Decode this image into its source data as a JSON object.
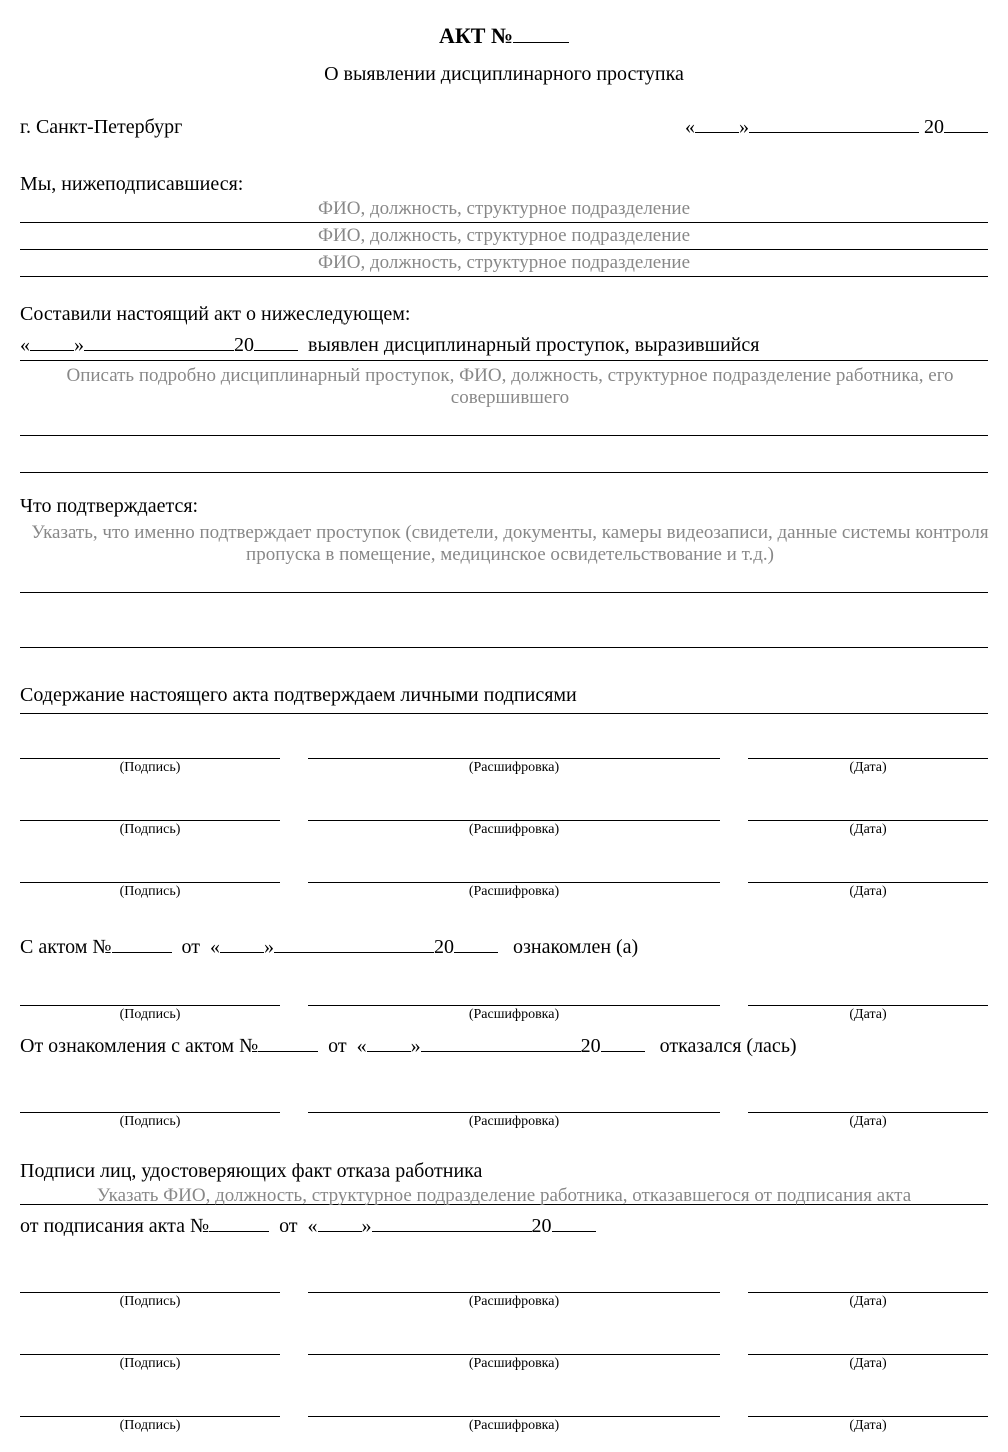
{
  "header": {
    "act_label": "АКТ №",
    "subtitle": "О выявлении дисциплинарного проступка"
  },
  "city": "г. Санкт-Петербург",
  "date_parts": {
    "open": "«",
    "close": "»",
    "year_prefix": "20"
  },
  "signers_intro": "Мы, нижеподписавшиеся:",
  "signers_hint": "ФИО, должность, структурное подразделение",
  "act_body": {
    "intro": "Составили настоящий акт о нижеследующем:",
    "detected_text": "выявлен дисциплинарный проступок, выразившийся",
    "detected_hint": "Описать подробно дисциплинарный проступок, ФИО, должность, структурное подразделение работника, его совершившего"
  },
  "confirm": {
    "label": "Что подтверждается:",
    "hint": "Указать, что именно подтверждает проступок (свидетели, документы, камеры видеозаписи, данные системы контроля пропуска в помещение, медицинское освидетельствование и т.д.)"
  },
  "signatures": {
    "heading": "Содержание настоящего акта подтверждаем личными подписями",
    "col_signature": "(Подпись)",
    "col_decipher": "(Расшифровка)",
    "col_date": "(Дата)"
  },
  "acquaint": {
    "prefix": "С актом №",
    "from": "от",
    "suffix": "ознакомлен (а)"
  },
  "refuse": {
    "prefix": "От ознакомления с актом №",
    "from": "от",
    "suffix": "отказался (лась)"
  },
  "refuse_witness": {
    "heading": "Подписи лиц, удостоверяющих факт отказа работника",
    "hint": "Указать ФИО, должность, структурное подразделение работника, отказавшегося от подписания акта",
    "line_prefix": "от подписания акта №",
    "from": "от"
  }
}
